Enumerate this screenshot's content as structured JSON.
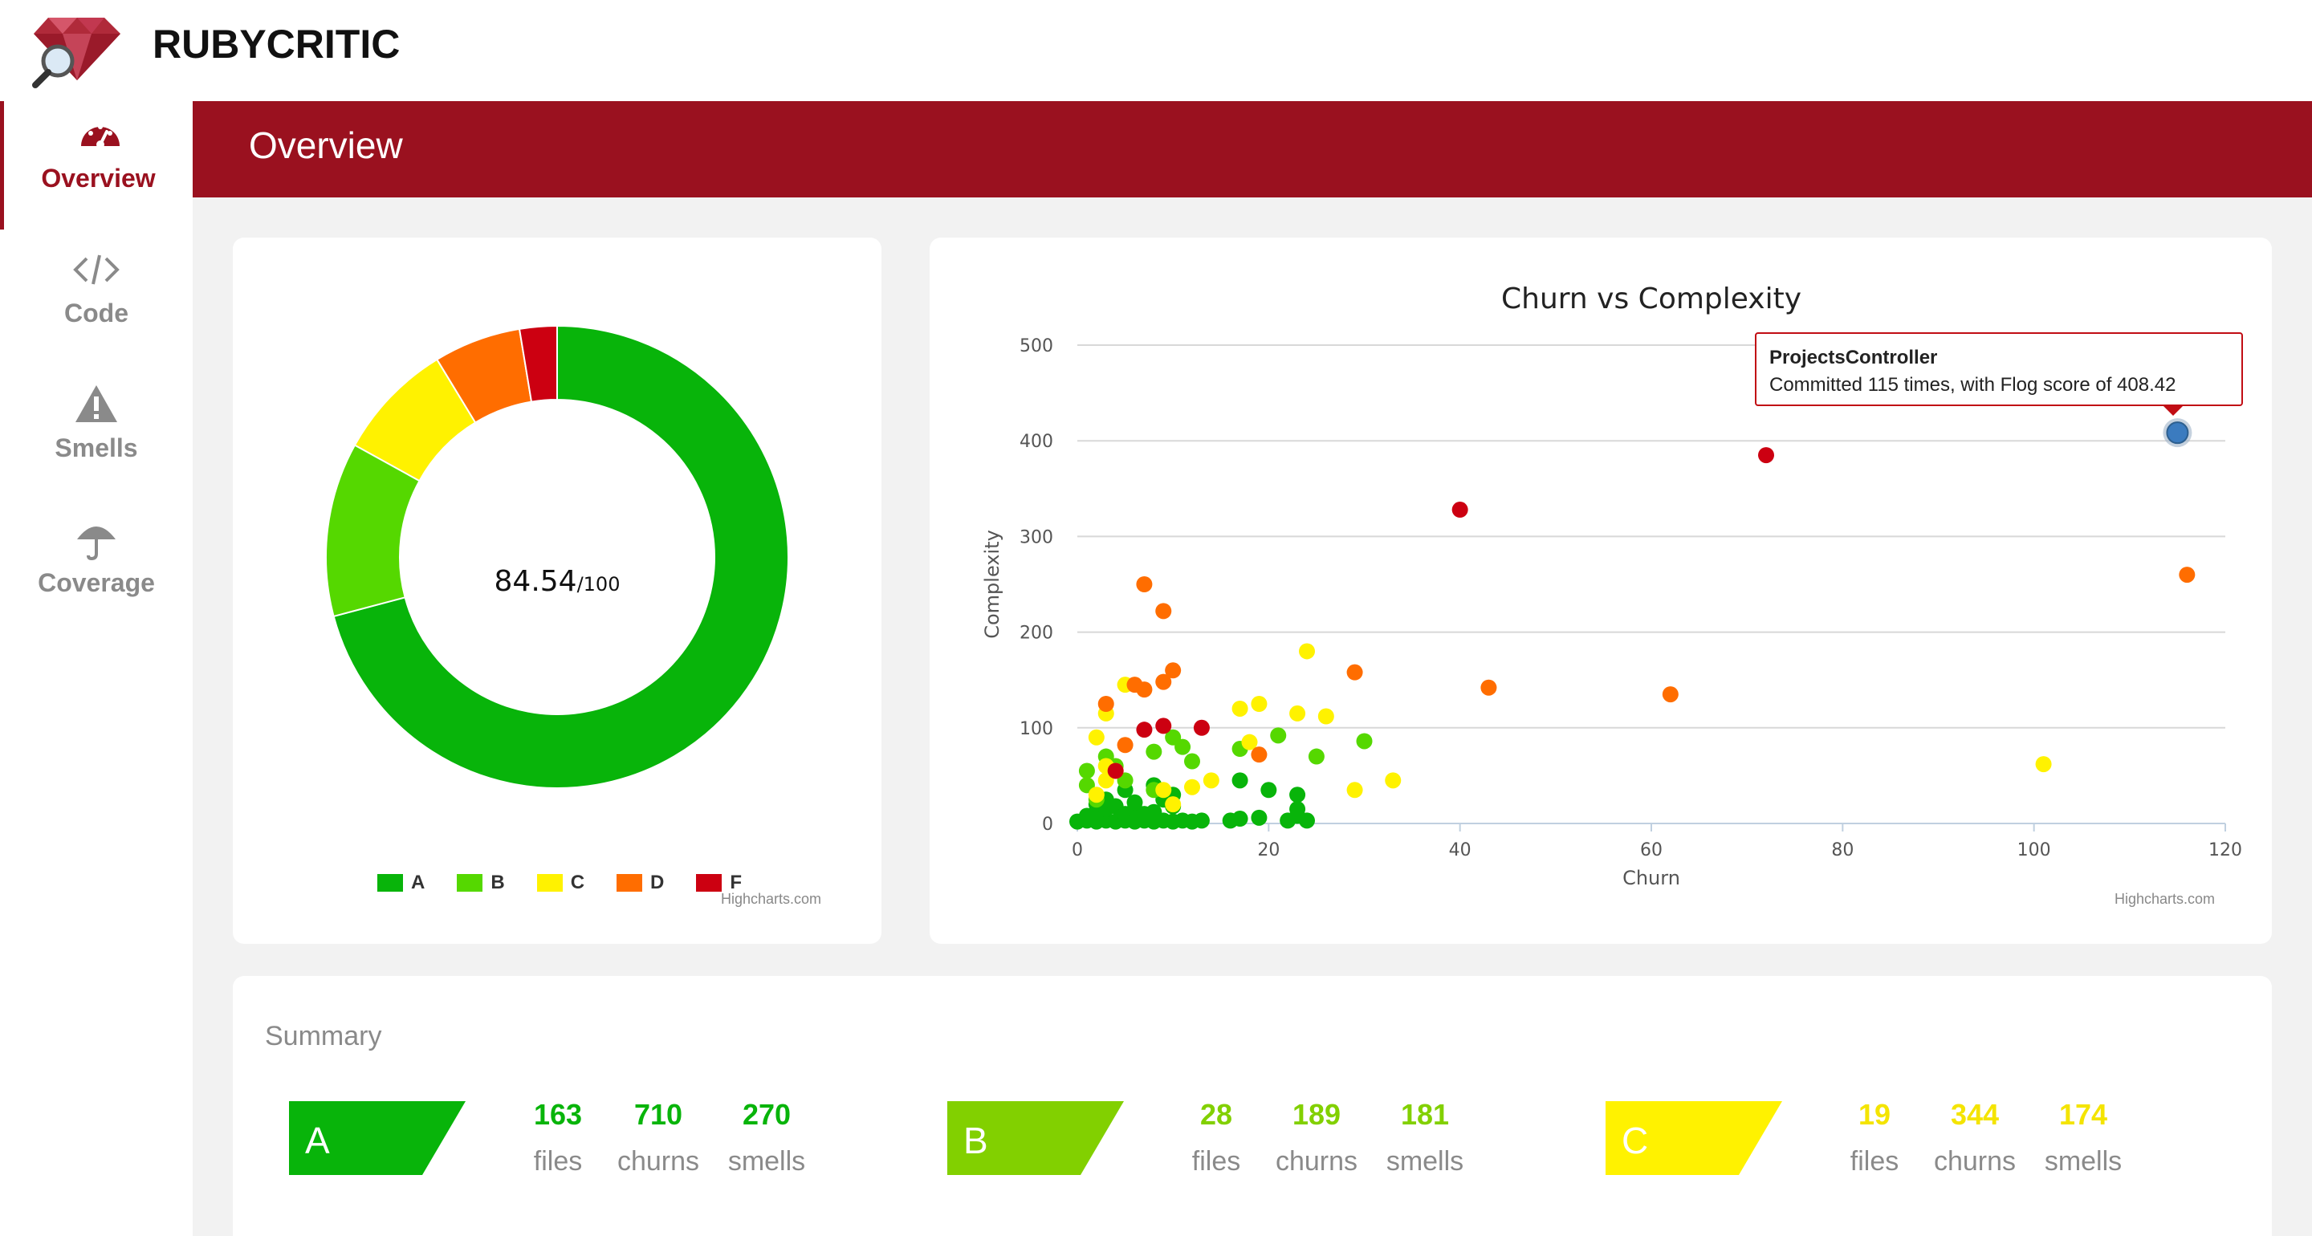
{
  "app": {
    "name": "RUBYCRITIC"
  },
  "sidebar": {
    "items": [
      {
        "label": "Overview",
        "icon": "dashboard-gauge-icon",
        "active": true
      },
      {
        "label": "Code",
        "icon": "code-brackets-icon",
        "active": false
      },
      {
        "label": "Smells",
        "icon": "warning-triangle-icon",
        "active": false
      },
      {
        "label": "Coverage",
        "icon": "umbrella-icon",
        "active": false
      }
    ]
  },
  "header": {
    "title": "Overview"
  },
  "colors": {
    "brand": "#9a111f",
    "A": "#08b40a",
    "B": "#55d800",
    "C": "#fff200",
    "D": "#ff6d00",
    "F": "#cc0011",
    "tooltip_border": "#c10d14",
    "highlight": "#3b7bbf"
  },
  "donut": {
    "score": "84.54",
    "score_suffix": "/100",
    "credits": "Highcharts.com"
  },
  "scatter": {
    "credits": "Highcharts.com",
    "tooltip": {
      "title": "ProjectsController",
      "text": "Committed 115 times, with Flog score of 408.42"
    }
  },
  "chart_data": [
    {
      "type": "pie",
      "variant": "donut",
      "labels": [
        "A",
        "B",
        "C",
        "D",
        "F"
      ],
      "values": [
        163,
        28,
        19,
        14,
        6
      ],
      "colors": [
        "#08b40a",
        "#55d800",
        "#fff200",
        "#ff6d00",
        "#cc0011"
      ],
      "legend": "bottom-center"
    },
    {
      "type": "scatter",
      "title": "Churn vs Complexity",
      "xlabel": "Churn",
      "ylabel": "Complexity",
      "xlim": [
        0,
        120
      ],
      "ylim": [
        0,
        500
      ],
      "xticks": [
        0,
        20,
        40,
        60,
        80,
        100,
        120
      ],
      "yticks": [
        0,
        100,
        200,
        300,
        400,
        500
      ],
      "grid": true,
      "series": [
        {
          "grade": "A",
          "color": "#08b40a",
          "points": [
            [
              0,
              2
            ],
            [
              1,
              3
            ],
            [
              1,
              8
            ],
            [
              2,
              2
            ],
            [
              2,
              12
            ],
            [
              2,
              20
            ],
            [
              3,
              3
            ],
            [
              3,
              15
            ],
            [
              3,
              25
            ],
            [
              4,
              2
            ],
            [
              4,
              18
            ],
            [
              5,
              3
            ],
            [
              5,
              10
            ],
            [
              5,
              35
            ],
            [
              6,
              2
            ],
            [
              6,
              15
            ],
            [
              6,
              22
            ],
            [
              7,
              3
            ],
            [
              7,
              10
            ],
            [
              8,
              2
            ],
            [
              8,
              12
            ],
            [
              8,
              40
            ],
            [
              9,
              3
            ],
            [
              9,
              25
            ],
            [
              10,
              2
            ],
            [
              10,
              18
            ],
            [
              10,
              30
            ],
            [
              11,
              3
            ],
            [
              12,
              2
            ],
            [
              13,
              3
            ],
            [
              16,
              3
            ],
            [
              17,
              5
            ],
            [
              17,
              45
            ],
            [
              19,
              6
            ],
            [
              20,
              35
            ],
            [
              22,
              3
            ],
            [
              23,
              8
            ],
            [
              23,
              15
            ],
            [
              23,
              30
            ],
            [
              24,
              3
            ]
          ]
        },
        {
          "grade": "B",
          "color": "#55d800",
          "points": [
            [
              1,
              55
            ],
            [
              1,
              40
            ],
            [
              2,
              25
            ],
            [
              3,
              70
            ],
            [
              4,
              60
            ],
            [
              5,
              45
            ],
            [
              8,
              35
            ],
            [
              8,
              75
            ],
            [
              10,
              90
            ],
            [
              11,
              80
            ],
            [
              12,
              65
            ],
            [
              17,
              78
            ],
            [
              21,
              92
            ],
            [
              25,
              70
            ],
            [
              30,
              86
            ]
          ]
        },
        {
          "grade": "C",
          "color": "#fff200",
          "points": [
            [
              2,
              30
            ],
            [
              2,
              90
            ],
            [
              3,
              60
            ],
            [
              3,
              45
            ],
            [
              3,
              115
            ],
            [
              4,
              55
            ],
            [
              5,
              145
            ],
            [
              9,
              35
            ],
            [
              10,
              20
            ],
            [
              12,
              38
            ],
            [
              14,
              45
            ],
            [
              17,
              120
            ],
            [
              18,
              85
            ],
            [
              19,
              125
            ],
            [
              24,
              180
            ],
            [
              23,
              115
            ],
            [
              26,
              112
            ],
            [
              29,
              35
            ],
            [
              33,
              45
            ],
            [
              101,
              62
            ]
          ]
        },
        {
          "grade": "D",
          "color": "#ff6d00",
          "points": [
            [
              3,
              125
            ],
            [
              5,
              82
            ],
            [
              6,
              145
            ],
            [
              7,
              250
            ],
            [
              7,
              140
            ],
            [
              9,
              222
            ],
            [
              9,
              148
            ],
            [
              10,
              160
            ],
            [
              19,
              72
            ],
            [
              29,
              158
            ],
            [
              43,
              142
            ],
            [
              62,
              135
            ],
            [
              116,
              260
            ]
          ]
        },
        {
          "grade": "F",
          "color": "#cc0011",
          "points": [
            [
              4,
              55
            ],
            [
              7,
              98
            ],
            [
              9,
              102
            ],
            [
              13,
              100
            ],
            [
              40,
              328
            ],
            [
              72,
              385
            ]
          ]
        },
        {
          "grade": "highlight",
          "color": "#3b7bbf",
          "points": [
            [
              115,
              408.42
            ]
          ]
        }
      ]
    }
  ],
  "summary": {
    "title": "Summary",
    "grades": [
      {
        "letter": "A",
        "color": "#08b40a",
        "files": "163",
        "churns": "710",
        "smells": "270"
      },
      {
        "letter": "B",
        "color": "#82d000",
        "files": "28",
        "churns": "189",
        "smells": "181"
      },
      {
        "letter": "C",
        "color": "#fff200",
        "files": "19",
        "churns": "344",
        "smells": "174"
      }
    ],
    "captions": {
      "files": "files",
      "churns": "churns",
      "smells": "smells"
    }
  }
}
